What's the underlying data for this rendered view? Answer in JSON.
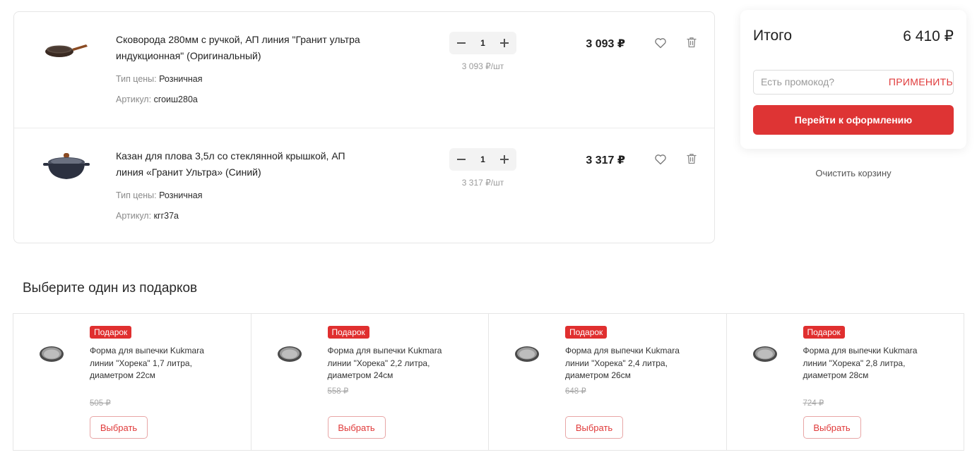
{
  "cart": {
    "items": [
      {
        "title": "Сковорода 280мм с ручкой, АП линия \"Гранит ультра индукционная\" (Оригинальный)",
        "price_type_label": "Тип цены:",
        "price_type": "Розничная",
        "sku_label": "Артикул:",
        "sku": "сгоиш280а",
        "quantity": "1",
        "unit_price": "3 093 ₽/шт",
        "total": "3 093 ₽",
        "image_icon": "frying-pan-icon"
      },
      {
        "title": "Казан для плова 3,5л со стеклянной крышкой, АП линия «Гранит Ультра» (Синий)",
        "price_type_label": "Тип цены:",
        "price_type": "Розничная",
        "sku_label": "Артикул:",
        "sku": "кгг37а",
        "quantity": "1",
        "unit_price": "3 317 ₽/шт",
        "total": "3 317 ₽",
        "image_icon": "cauldron-pot-icon"
      }
    ]
  },
  "summary": {
    "total_label": "Итого",
    "total_value": "6 410 ₽",
    "promo_placeholder": "Есть промокод?",
    "apply_label": "ПРИМЕНИТЬ",
    "checkout_label": "Перейти к оформлению",
    "clear_label": "Очистить корзину"
  },
  "gifts": {
    "title": "Выберите один из подарков",
    "items": [
      {
        "badge": "Подарок",
        "name": "Форма для выпечки Kukmara линии \"Хорека\" 1,7 литра, диаметром 22см",
        "old_price": "505 ₽",
        "button": "Выбрать"
      },
      {
        "badge": "Подарок",
        "name": "Форма для выпечки Kukmara линии \"Хорека\" 2,2 литра, диаметром 24см",
        "old_price": "558 ₽",
        "button": "Выбрать"
      },
      {
        "badge": "Подарок",
        "name": "Форма для выпечки Kukmara линии \"Хорека\" 2,4 литра, диаметром 26см",
        "old_price": "648 ₽",
        "button": "Выбрать"
      },
      {
        "badge": "Подарок",
        "name": "Форма для выпечки Kukmara линии \"Хорека\" 2,8 литра, диаметром 28см",
        "old_price": "724 ₽",
        "button": "Выбрать"
      }
    ]
  },
  "colors": {
    "accent": "#de3434",
    "badge": "#e02f2f",
    "muted_text": "#8a8a8a",
    "border": "#e6e6e6"
  }
}
